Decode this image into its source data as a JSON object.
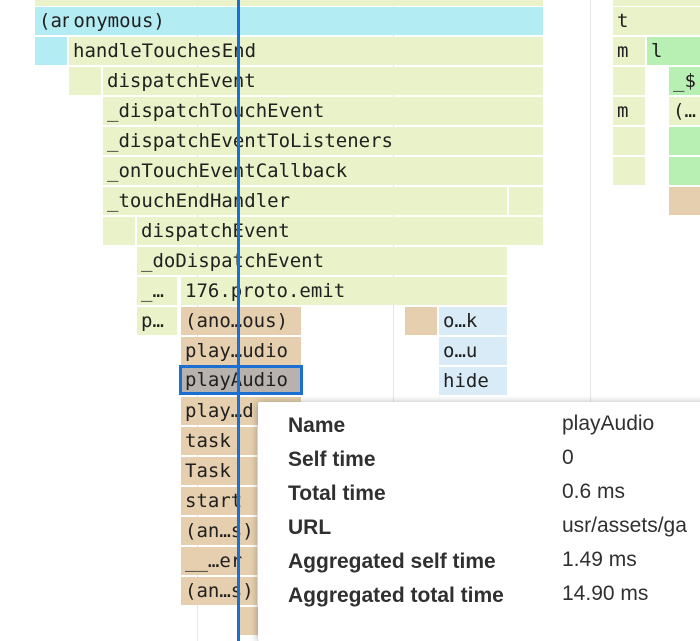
{
  "colors": {
    "cyan": "#b3ecf2",
    "green": "#e9f2c8",
    "tan": "#e5cfae",
    "blue": "#d9ebf6",
    "brightgreen": "#b8efb2",
    "selected_outline": "#1a6fd1",
    "cursor_line": "#1a6fd1"
  },
  "flame_rows": [
    [
      "",
      "",
      "",
      ""
    ],
    [
      "(anonymous)",
      "t"
    ],
    [
      "handleTouchesEnd",
      "m",
      "l"
    ],
    [
      "dispatchEvent",
      "_$"
    ],
    [
      "_dispatchTouchEvent",
      "m",
      "(…"
    ],
    [
      "_dispatchEventToListeners"
    ],
    [
      "_onTouchEventCallback"
    ],
    [
      "_touchEndHandler"
    ],
    [
      "dispatchEvent"
    ],
    [
      "_doDispatchEvent"
    ],
    [
      "_…",
      "176.proto.emit"
    ],
    [
      "p…",
      "(ano…ous)",
      "o…k"
    ],
    [
      "play…udio",
      "o…u"
    ],
    [
      "playAudio",
      "hide"
    ],
    [
      "play…d"
    ],
    [
      "task"
    ],
    [
      "Task"
    ],
    [
      "start"
    ],
    [
      "(an…s)"
    ],
    [
      "__…er"
    ],
    [
      "(an…s)"
    ]
  ],
  "tooltip": {
    "rows": [
      {
        "label": "Name",
        "value": "playAudio"
      },
      {
        "label": "Self time",
        "value": "0"
      },
      {
        "label": "Total time",
        "value": "0.6 ms"
      },
      {
        "label": "URL",
        "value": "usr/assets/ga"
      },
      {
        "label": "Aggregated self time",
        "value": "1.49 ms"
      },
      {
        "label": "Aggregated total time",
        "value": "14.90 ms"
      }
    ]
  }
}
